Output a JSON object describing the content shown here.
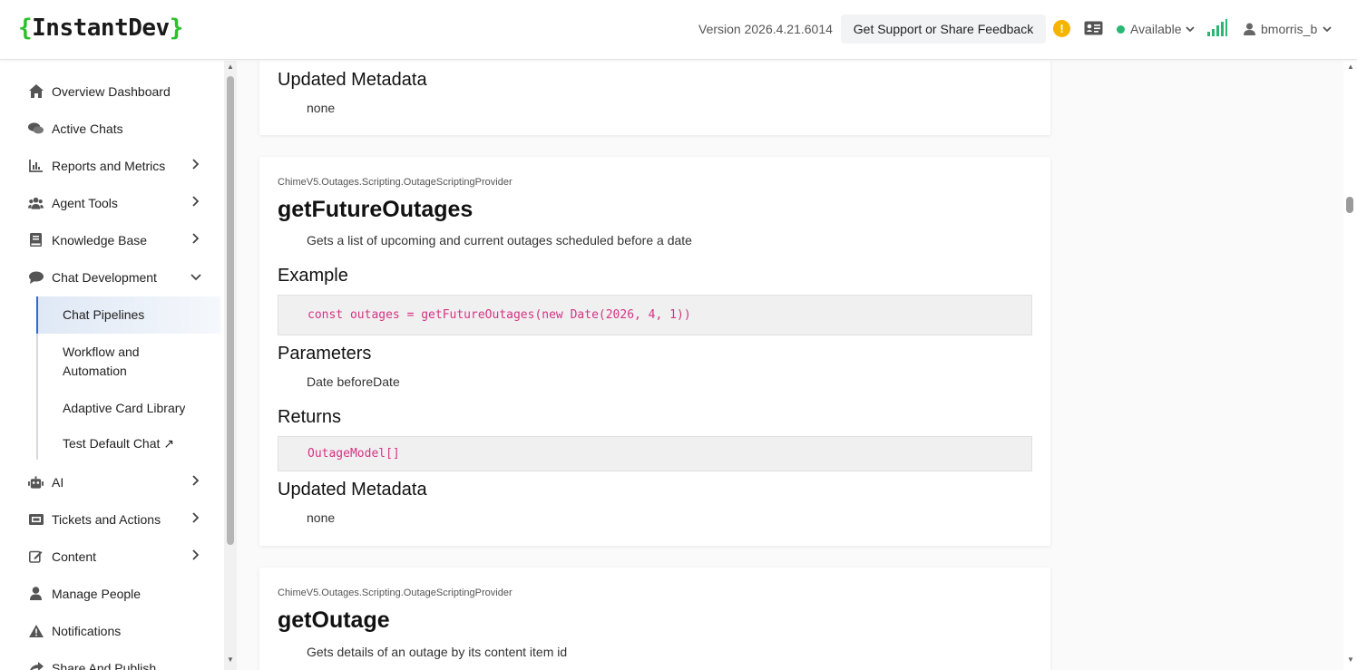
{
  "header": {
    "logo_open": "{",
    "logo_text": "InstantDev",
    "logo_close": "}",
    "version": "Version 2026.4.21.6014",
    "support_label": "Get Support or Share Feedback",
    "alert_glyph": "!",
    "status_label": "Available",
    "status_color": "#2bb673",
    "username": "bmorris_b"
  },
  "sidebar": {
    "items": [
      {
        "label": "Overview Dashboard",
        "icon": "home-icon"
      },
      {
        "label": "Active Chats",
        "icon": "chat-bubbles-icon"
      },
      {
        "label": "Reports and Metrics",
        "icon": "bar-chart-icon"
      },
      {
        "label": "Agent Tools",
        "icon": "users-icon"
      },
      {
        "label": "Knowledge Base",
        "icon": "book-icon"
      },
      {
        "label": "Chat Development",
        "icon": "chat-bubble-icon"
      },
      {
        "label": "AI",
        "icon": "robot-icon"
      },
      {
        "label": "Tickets and Actions",
        "icon": "ticket-icon"
      },
      {
        "label": "Content",
        "icon": "edit-icon"
      },
      {
        "label": "Manage People",
        "icon": "person-icon"
      },
      {
        "label": "Notifications",
        "icon": "warning-icon"
      },
      {
        "label": "Share And Publish",
        "icon": "share-icon"
      }
    ],
    "sub_items": [
      {
        "label": "Chat Pipelines",
        "active": true
      },
      {
        "label": "Workflow and Automation",
        "active": false
      },
      {
        "label": "Adaptive Card Library",
        "active": false
      },
      {
        "label": "Test Default Chat ↗",
        "active": false
      }
    ]
  },
  "main": {
    "card1": {
      "updated_metadata_heading": "Updated Metadata",
      "updated_metadata_value": "none"
    },
    "card2": {
      "namespace": "ChimeV5.Outages.Scripting.OutageScriptingProvider",
      "function_name": "getFutureOutages",
      "description": "Gets a list of upcoming and current outages scheduled before a date",
      "example_heading": "Example",
      "example_code": "const outages = getFutureOutages(new Date(2026, 4, 1))",
      "parameters_heading": "Parameters",
      "parameters_value": "Date beforeDate",
      "returns_heading": "Returns",
      "returns_code": "OutageModel[]",
      "updated_metadata_heading": "Updated Metadata",
      "updated_metadata_value": "none"
    },
    "card3": {
      "namespace": "ChimeV5.Outages.Scripting.OutageScriptingProvider",
      "function_name": "getOutage",
      "description": "Gets details of an outage by its content item id"
    }
  }
}
